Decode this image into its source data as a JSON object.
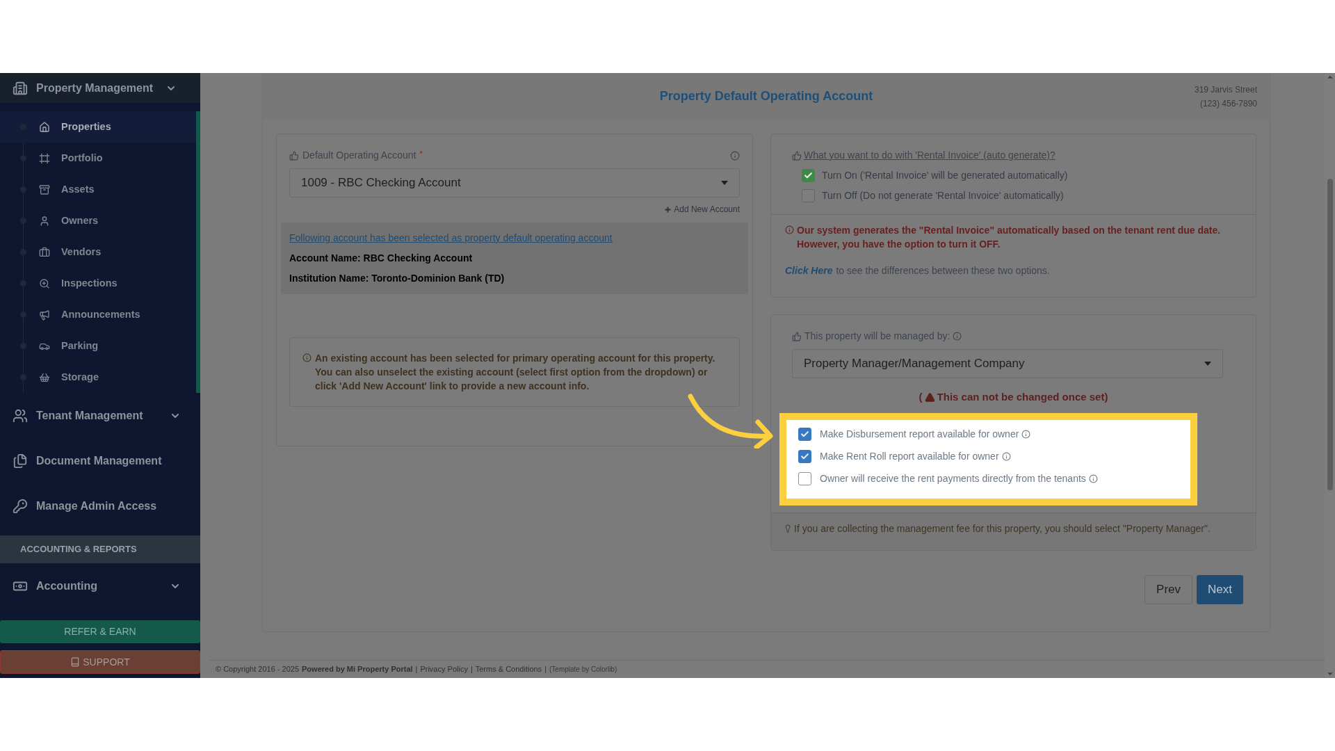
{
  "sidebar": {
    "nav": [
      {
        "kind": "group",
        "label": "Property Management",
        "children": [
          {
            "label": "Properties",
            "selected": true
          },
          {
            "label": "Portfolio",
            "selected": false
          },
          {
            "label": "Assets",
            "selected": false
          },
          {
            "label": "Owners",
            "selected": false
          },
          {
            "label": "Vendors",
            "selected": false
          },
          {
            "label": "Inspections",
            "selected": false
          },
          {
            "label": "Announcements",
            "selected": false
          },
          {
            "label": "Parking",
            "selected": false
          },
          {
            "label": "Storage",
            "selected": false
          }
        ]
      },
      {
        "kind": "group",
        "label": "Tenant Management"
      },
      {
        "kind": "link",
        "label": "Document Management"
      },
      {
        "kind": "link",
        "label": "Manage Admin Access"
      },
      {
        "kind": "heading",
        "label": "ACCOUNTING & REPORTS"
      },
      {
        "kind": "group",
        "label": "Accounting"
      }
    ],
    "buttons": [
      {
        "kind": "refer",
        "label": "REFER & EARN"
      },
      {
        "kind": "support",
        "label": "SUPPORT"
      }
    ]
  },
  "page": {
    "title": "Property Default Operating Account",
    "address": "319 Jarvis Street",
    "phone": "(123) 456-7890"
  },
  "account_panel": {
    "label": "Default Operating Account",
    "required_mark": "*",
    "select_value": "1009 - RBC Checking Account",
    "add_link": "Add New Account",
    "selected_heading": "Following account has been selected as property default operating account",
    "details": [
      "Account Name: RBC Checking Account",
      "Institution Name: Toronto-Dominion Bank (TD)"
    ],
    "note": "An existing account has been selected for primary operating account for this property. You can also unselect the existing account (select first option from the dropdown) or click 'Add New Account' link to provide a new account info."
  },
  "invoice_panel": {
    "question": "What you want to do with 'Rental Invoice' (auto generate)?",
    "options": [
      {
        "label": "Turn On ('Rental Invoice' will be generated automatically)",
        "checked": true
      },
      {
        "label": "Turn Off (Do not generate 'Rental Invoice' automatically)",
        "checked": false
      }
    ],
    "warning": "Our system generates the \"Rental Invoice\" automatically based on the tenant rent due date. However, you have the option to turn it OFF.",
    "click_link": "Click Here",
    "click_rest": "to see the differences between these two options."
  },
  "manager_panel": {
    "label": "This property will be managed by:",
    "select_value": "Property Manager/Management Company",
    "lock_note_open": "(",
    "lock_note": "This can not be changed once set)",
    "options": [
      {
        "label": "Make Disbursement report available for owner",
        "checked": true
      },
      {
        "label": "Make Rent Roll report available for owner",
        "checked": true
      },
      {
        "label": "Owner will receive the rent payments directly from the tenants",
        "checked": false
      }
    ],
    "tip": "If you are collecting the management fee for this property, you should select \"Property Manager\"."
  },
  "nav_buttons": [
    "Prev",
    "Next"
  ],
  "footer": {
    "copyright": "© Copyright 2016 - 2025",
    "powered": "Powered by Mi Property Portal",
    "links": [
      "Privacy Policy",
      "Terms & Conditions"
    ],
    "separator": "|",
    "template": "(Template by Colorlib)"
  }
}
